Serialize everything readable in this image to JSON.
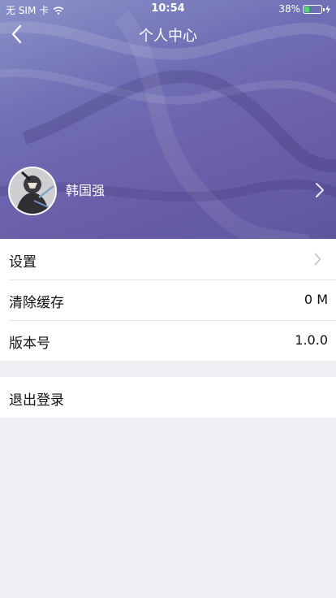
{
  "status_bar": {
    "carrier": "无 SIM 卡",
    "time": "10:54",
    "battery_percent": "38%",
    "battery_level": 0.38
  },
  "nav": {
    "title": "个人中心"
  },
  "profile": {
    "username": "韩国强"
  },
  "settings_list": [
    {
      "label": "设置",
      "value": ""
    },
    {
      "label": "清除缓存",
      "value": "0 M"
    },
    {
      "label": "版本号",
      "value": "1.0.0"
    }
  ],
  "logout": {
    "label": "退出登录"
  },
  "colors": {
    "header_accent": "#6b66b0",
    "background": "#efeff4",
    "battery_fill": "#4cd964"
  }
}
